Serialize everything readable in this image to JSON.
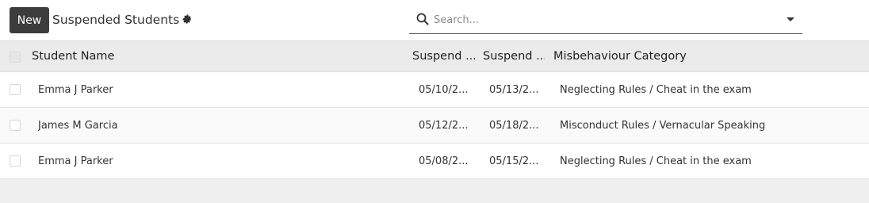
{
  "toolbar": {
    "new_label": "New",
    "title": "Suspended Students"
  },
  "search": {
    "placeholder": "Search...",
    "value": ""
  },
  "table": {
    "columns": {
      "name": "Student Name",
      "suspend_from": "Suspend ...",
      "suspend_to": "Suspend ...",
      "category": "Misbehaviour Category"
    },
    "rows": [
      {
        "name": "Emma J Parker",
        "from": "05/10/2...",
        "to": "05/13/2...",
        "category": "Neglecting Rules / Cheat in the exam"
      },
      {
        "name": "James M Garcia",
        "from": "05/12/2...",
        "to": "05/18/2...",
        "category": "Misconduct Rules / Vernacular Speaking"
      },
      {
        "name": "Emma J Parker",
        "from": "05/08/2...",
        "to": "05/15/2...",
        "category": "Neglecting Rules / Cheat in the exam"
      }
    ]
  }
}
